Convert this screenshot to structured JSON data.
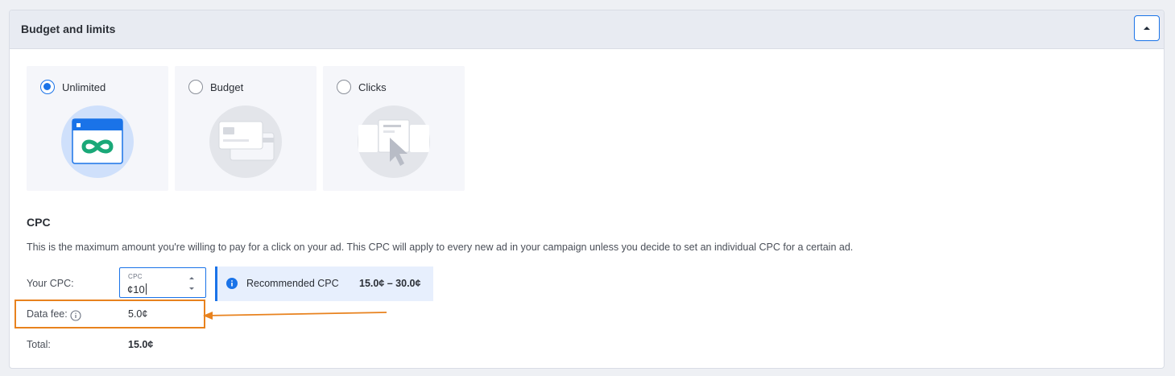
{
  "section": {
    "title": "Budget and limits"
  },
  "options": [
    {
      "label": "Unlimited",
      "selected": true
    },
    {
      "label": "Budget",
      "selected": false
    },
    {
      "label": "Clicks",
      "selected": false
    }
  ],
  "cpc": {
    "heading": "CPC",
    "description": "This is the maximum amount you're willing to pay for a click on your ad. This CPC will apply to every new ad in your campaign unless you decide to set an individual CPC for a certain ad.",
    "your_cpc_label": "Your CPC:",
    "input_label": "CPC",
    "input_value": "¢10",
    "recommended_label": "Recommended CPC",
    "recommended_range": "15.0¢ – 30.0¢",
    "data_fee_label": "Data fee:",
    "data_fee_value": "5.0¢",
    "total_label": "Total:",
    "total_value": "15.0¢"
  },
  "colors": {
    "accent": "#1a73e8",
    "highlight": "#e8821e",
    "infinity": "#1aa878"
  }
}
